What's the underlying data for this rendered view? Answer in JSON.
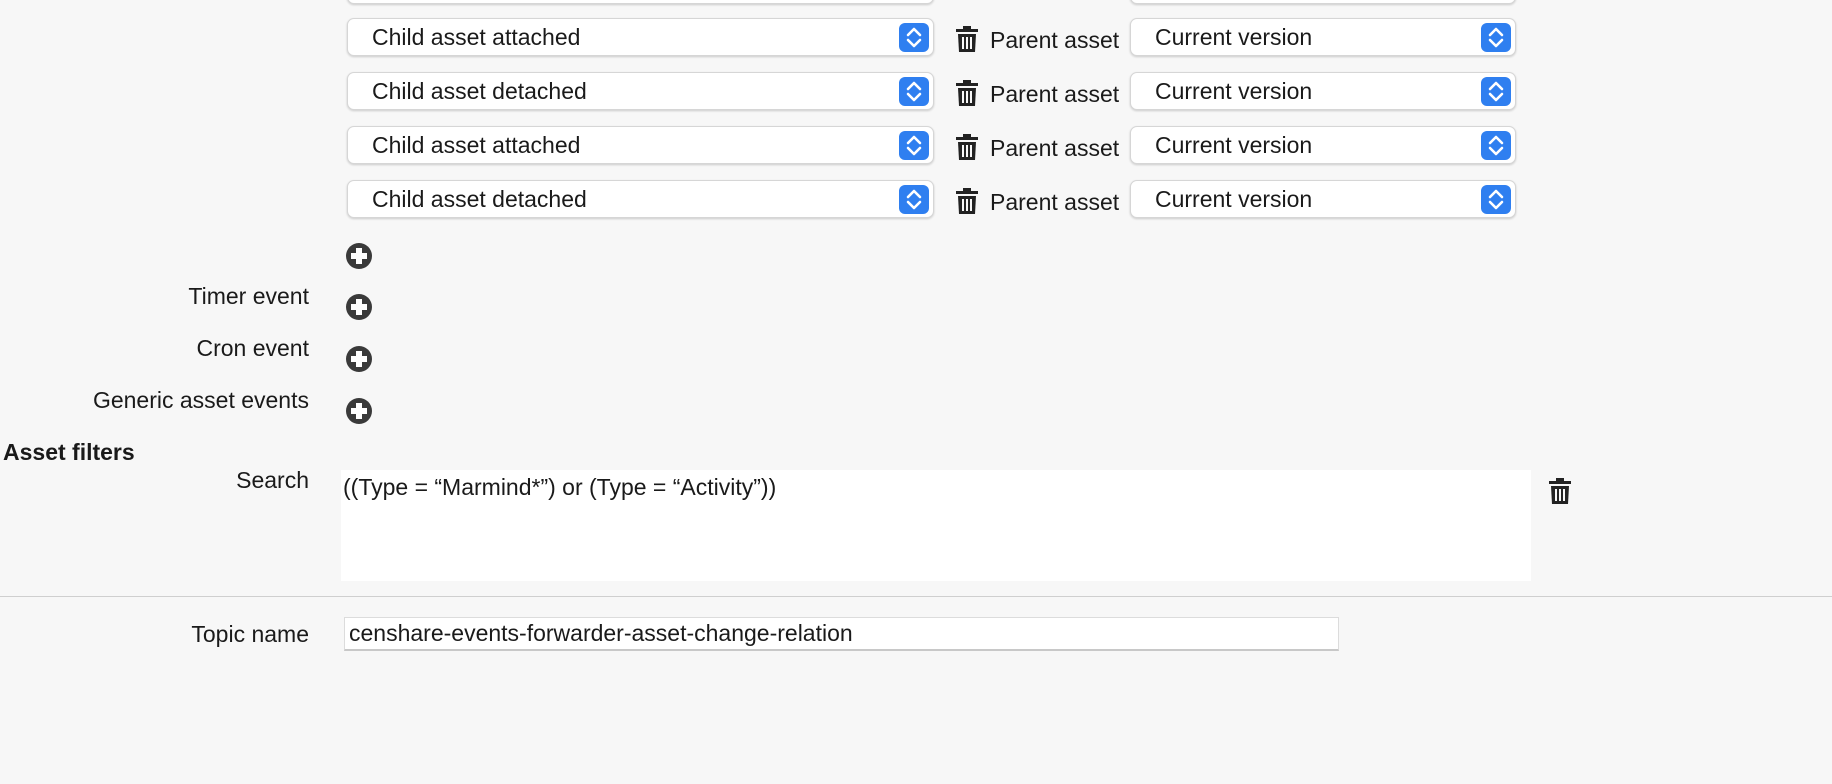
{
  "event_rows": [
    {
      "event": "Child asset attached",
      "relation_label": "Parent asset",
      "version": "Current version"
    },
    {
      "event": "Child asset detached",
      "relation_label": "Parent asset",
      "version": "Current version"
    },
    {
      "event": "Child asset attached",
      "relation_label": "Parent asset",
      "version": "Current version"
    },
    {
      "event": "Child asset detached",
      "relation_label": "Parent asset",
      "version": "Current version"
    }
  ],
  "labels": {
    "timer_event": "Timer event",
    "cron_event": "Cron event",
    "generic_asset_events": "Generic asset events",
    "asset_filters": "Asset filters",
    "search": "Search",
    "topic_name": "Topic name"
  },
  "search": {
    "query": "((Type = “Marmind*”) or (Type = “Activity”))"
  },
  "topic": {
    "value": "censhare-events-forwarder-asset-change-relation"
  },
  "icons": {
    "add": "plus-circle-icon",
    "delete": "trash-icon",
    "select_arrows": "up-down-chevron-icon"
  },
  "colors": {
    "accent": "#2f7ff0",
    "background": "#f7f7f7"
  }
}
